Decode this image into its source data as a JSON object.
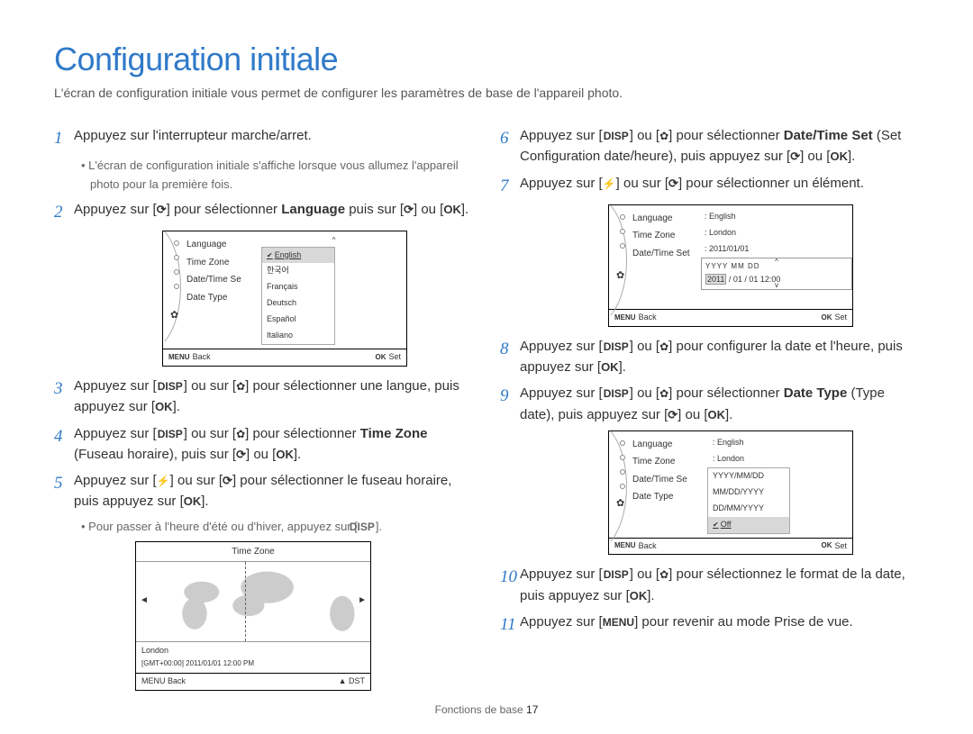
{
  "title": "Configuration initiale",
  "subtitle": "L'écran de configuration initiale vous permet de configurer les paramètres de base de l'appareil photo.",
  "icons": {
    "disp": "DISP",
    "ok": "OK",
    "menu": "MENU",
    "timer": "↻",
    "flash": "⚡",
    "macro": "❀",
    "up": "▲"
  },
  "steps": {
    "s1": "Appuyez sur l'interrupteur marche/arret.",
    "s1_note": "L'écran de configuration initiale s'affiche lorsque vous allumez l'appareil photo pour la première fois.",
    "s2_a": "Appuyez sur [",
    "s2_b": "] pour sélectionner ",
    "s2_term": "Language",
    "s2_c": " puis sur [",
    "s2_d": "] ou [",
    "s2_e": "].",
    "s3_a": "Appuyez sur [",
    "s3_b": "] ou sur [",
    "s3_c": "] pour sélectionner une langue, puis appuyez sur [",
    "s3_d": "].",
    "s4_a": "Appuyez sur [",
    "s4_b": "] ou sur [",
    "s4_c": "] pour sélectionner ",
    "s4_term": "Time Zone",
    "s4_d": " (Fuseau horaire), puis sur [",
    "s4_e": "] ou [",
    "s4_f": "].",
    "s5_a": "Appuyez sur [",
    "s5_b": "] ou sur [",
    "s5_c": "] pour sélectionner le fuseau horaire, puis appuyez sur [",
    "s5_d": "].",
    "s5_note_a": "Pour passer à l'heure d'été ou d'hiver, appuyez sur [",
    "s5_note_b": "].",
    "s6_a": "Appuyez sur [",
    "s6_b": "] ou [",
    "s6_c": "] pour sélectionner ",
    "s6_term": "Date/Time Set",
    "s6_d": " (Set Configuration date/heure), puis appuyez sur [",
    "s6_e": "] ou [",
    "s6_f": "].",
    "s7_a": "Appuyez sur [",
    "s7_b": "] ou sur [",
    "s7_c": "] pour sélectionner un élément.",
    "s8_a": "Appuyez sur [",
    "s8_b": "] ou [",
    "s8_c": "] pour configurer la date et l'heure, puis appuyez sur [",
    "s8_d": "].",
    "s9_a": "Appuyez sur [",
    "s9_b": "] ou [",
    "s9_c": "] pour sélectionner ",
    "s9_term": "Date Type",
    "s9_d": " (Type date), puis appuyez sur [",
    "s9_e": "] ou [",
    "s9_f": "].",
    "s10_a": "Appuyez sur [",
    "s10_b": "] ou [",
    "s10_c": "] pour sélectionnez le format de la date, puis appuyez sur [",
    "s10_d": "].",
    "s11_a": "Appuyez sur [",
    "s11_b": "] pour revenir au mode Prise de vue."
  },
  "mini1": {
    "left": [
      "Language",
      "Time Zone",
      "Date/Time Se",
      "Date Type"
    ],
    "langs": [
      "English",
      "한국어",
      "Français",
      "Deutsch",
      "Español",
      "Italiano"
    ],
    "footer_back": "Back",
    "footer_set": "Set"
  },
  "mini2": {
    "left": [
      "Language",
      "Time Zone",
      "Date/Time Set"
    ],
    "vals": [
      ": English",
      ": London",
      ": 2011/01/01"
    ],
    "dt_header": "YYYY MM DD",
    "dt_values": [
      "2011",
      " / 01 / 01  12:00"
    ],
    "footer_back": "Back",
    "footer_set": "Set"
  },
  "mini3": {
    "left": [
      "Language",
      "Time Zone",
      "Date/Time Se",
      "Date Type"
    ],
    "vals": [
      ": English",
      ": London"
    ],
    "opts": [
      "YYYY/MM/DD",
      "MM/DD/YYYY",
      "DD/MM/YYYY",
      "Off"
    ],
    "footer_back": "Back",
    "footer_set": "Set"
  },
  "tz": {
    "title": "Time Zone",
    "city": "London",
    "info": "[GMT+00:00]   2011/01/01   12:00 PM",
    "foot_back": "Back",
    "foot_dst": "DST"
  },
  "footer_section": "Fonctions de base ",
  "footer_page": "17"
}
